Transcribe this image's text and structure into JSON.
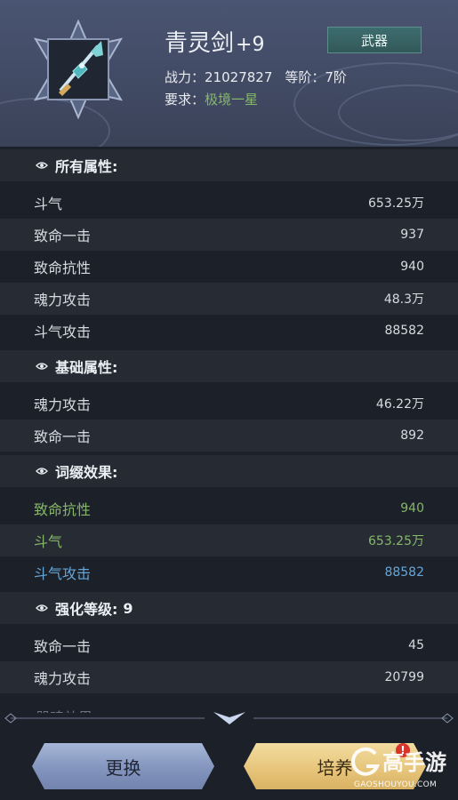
{
  "item": {
    "name": "青灵剑",
    "level": "+9",
    "type": "武器",
    "power_label": "战力：",
    "power_value": "21027827",
    "rank_label": "等阶：",
    "rank_value": "7阶",
    "req_label": "要求：",
    "req_value": "极境一星"
  },
  "sections": {
    "all": {
      "title": "所有属性:",
      "rows": [
        {
          "name": "斗气",
          "value": "653.25万"
        },
        {
          "name": "致命一击",
          "value": "937"
        },
        {
          "name": "致命抗性",
          "value": "940"
        },
        {
          "name": "魂力攻击",
          "value": "48.3万"
        },
        {
          "name": "斗气攻击",
          "value": "88582"
        }
      ]
    },
    "base": {
      "title": "基础属性:",
      "rows": [
        {
          "name": "魂力攻击",
          "value": "46.22万"
        },
        {
          "name": "致命一击",
          "value": "892"
        }
      ]
    },
    "affix": {
      "title": "词缀效果:",
      "rows": [
        {
          "name": "致命抗性",
          "value": "940",
          "color": "#86b76b"
        },
        {
          "name": "斗气",
          "value": "653.25万",
          "color": "#86b76b"
        },
        {
          "name": "斗气攻击",
          "value": "88582",
          "color": "#67a6d8"
        }
      ]
    },
    "enhance": {
      "title": "强化等级:",
      "level": "9",
      "rows": [
        {
          "name": "致命一击",
          "value": "45"
        },
        {
          "name": "魂力攻击",
          "value": "20799"
        }
      ]
    },
    "cutoff_title": "器魂效果:"
  },
  "buttons": {
    "replace": "更换",
    "cultivate": "培养",
    "alert": "!"
  },
  "watermark": {
    "name": "高手游",
    "url": "GAOSHOUYOU.COM"
  },
  "colors": {
    "green": "#86b76b",
    "blue": "#67a6d8",
    "badge_bg": "#325859"
  }
}
